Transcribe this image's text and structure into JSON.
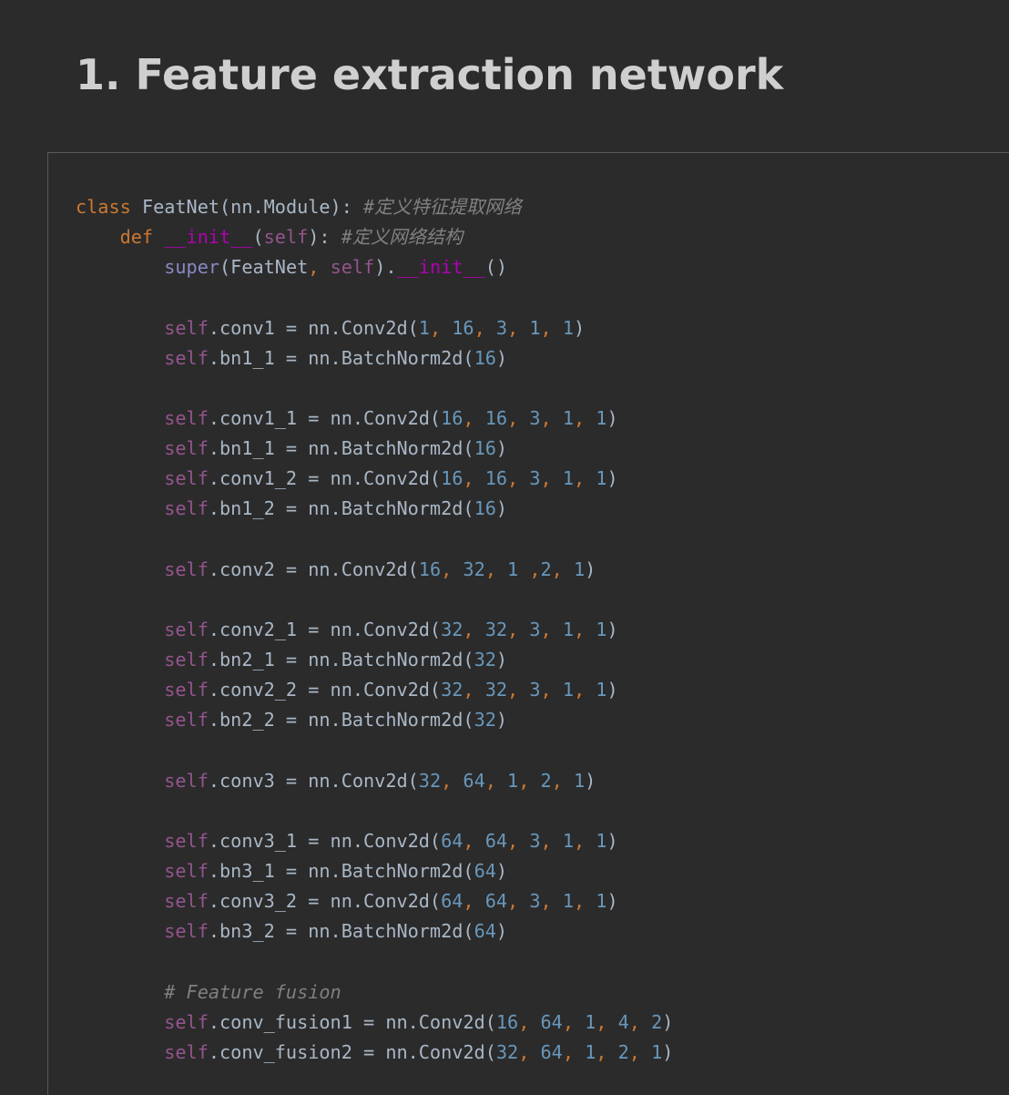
{
  "heading": "1. Feature extraction network",
  "colors": {
    "background": "#2b2b2b",
    "heading": "#cfcfcf",
    "keyword": "#cc7832",
    "self": "#94558d",
    "number": "#6897bb",
    "comment": "#808080",
    "magic": "#b200b2",
    "builtin": "#8888c6",
    "default": "#a9b7c6",
    "border": "#5a5a5a"
  },
  "code": {
    "lines": [
      [
        {
          "t": "kw",
          "v": "class "
        },
        {
          "t": "text",
          "v": "FeatNet(nn.Module): "
        },
        {
          "t": "comment",
          "v": "#定义特征提取网络"
        }
      ],
      [
        {
          "t": "ws",
          "v": "    "
        },
        {
          "t": "kw",
          "v": "def "
        },
        {
          "t": "magic",
          "v": "__init__"
        },
        {
          "t": "text",
          "v": "("
        },
        {
          "t": "self",
          "v": "self"
        },
        {
          "t": "text",
          "v": "): "
        },
        {
          "t": "comment",
          "v": "#定义网络结构"
        }
      ],
      [
        {
          "t": "ws",
          "v": "        "
        },
        {
          "t": "builtin",
          "v": "super"
        },
        {
          "t": "text",
          "v": "(FeatNet"
        },
        {
          "t": "punct",
          "v": ", "
        },
        {
          "t": "self",
          "v": "self"
        },
        {
          "t": "text",
          "v": ")."
        },
        {
          "t": "magic",
          "v": "__init__"
        },
        {
          "t": "text",
          "v": "()"
        }
      ],
      [],
      [
        {
          "t": "ws",
          "v": "        "
        },
        {
          "t": "self",
          "v": "self"
        },
        {
          "t": "text",
          "v": ".conv1 = nn.Conv2d("
        },
        {
          "t": "num",
          "v": "1"
        },
        {
          "t": "punct",
          "v": ", "
        },
        {
          "t": "num",
          "v": "16"
        },
        {
          "t": "punct",
          "v": ", "
        },
        {
          "t": "num",
          "v": "3"
        },
        {
          "t": "punct",
          "v": ", "
        },
        {
          "t": "num",
          "v": "1"
        },
        {
          "t": "punct",
          "v": ", "
        },
        {
          "t": "num",
          "v": "1"
        },
        {
          "t": "text",
          "v": ")"
        }
      ],
      [
        {
          "t": "ws",
          "v": "        "
        },
        {
          "t": "self",
          "v": "self"
        },
        {
          "t": "text",
          "v": ".bn1_1 = nn.BatchNorm2d("
        },
        {
          "t": "num",
          "v": "16"
        },
        {
          "t": "text",
          "v": ")"
        }
      ],
      [],
      [
        {
          "t": "ws",
          "v": "        "
        },
        {
          "t": "self",
          "v": "self"
        },
        {
          "t": "text",
          "v": ".conv1_1 = nn.Conv2d("
        },
        {
          "t": "num",
          "v": "16"
        },
        {
          "t": "punct",
          "v": ", "
        },
        {
          "t": "num",
          "v": "16"
        },
        {
          "t": "punct",
          "v": ", "
        },
        {
          "t": "num",
          "v": "3"
        },
        {
          "t": "punct",
          "v": ", "
        },
        {
          "t": "num",
          "v": "1"
        },
        {
          "t": "punct",
          "v": ", "
        },
        {
          "t": "num",
          "v": "1"
        },
        {
          "t": "text",
          "v": ")"
        }
      ],
      [
        {
          "t": "ws",
          "v": "        "
        },
        {
          "t": "self",
          "v": "self"
        },
        {
          "t": "text",
          "v": ".bn1_1 = nn.BatchNorm2d("
        },
        {
          "t": "num",
          "v": "16"
        },
        {
          "t": "text",
          "v": ")"
        }
      ],
      [
        {
          "t": "ws",
          "v": "        "
        },
        {
          "t": "self",
          "v": "self"
        },
        {
          "t": "text",
          "v": ".conv1_2 = nn.Conv2d("
        },
        {
          "t": "num",
          "v": "16"
        },
        {
          "t": "punct",
          "v": ", "
        },
        {
          "t": "num",
          "v": "16"
        },
        {
          "t": "punct",
          "v": ", "
        },
        {
          "t": "num",
          "v": "3"
        },
        {
          "t": "punct",
          "v": ", "
        },
        {
          "t": "num",
          "v": "1"
        },
        {
          "t": "punct",
          "v": ", "
        },
        {
          "t": "num",
          "v": "1"
        },
        {
          "t": "text",
          "v": ")"
        }
      ],
      [
        {
          "t": "ws",
          "v": "        "
        },
        {
          "t": "self",
          "v": "self"
        },
        {
          "t": "text",
          "v": ".bn1_2 = nn.BatchNorm2d("
        },
        {
          "t": "num",
          "v": "16"
        },
        {
          "t": "text",
          "v": ")"
        }
      ],
      [],
      [
        {
          "t": "ws",
          "v": "        "
        },
        {
          "t": "self",
          "v": "self"
        },
        {
          "t": "text",
          "v": ".conv2 = nn.Conv2d("
        },
        {
          "t": "num",
          "v": "16"
        },
        {
          "t": "punct",
          "v": ", "
        },
        {
          "t": "num",
          "v": "32"
        },
        {
          "t": "punct",
          "v": ", "
        },
        {
          "t": "num",
          "v": "1"
        },
        {
          "t": "punct",
          "v": " ,"
        },
        {
          "t": "num",
          "v": "2"
        },
        {
          "t": "punct",
          "v": ", "
        },
        {
          "t": "num",
          "v": "1"
        },
        {
          "t": "text",
          "v": ")"
        }
      ],
      [],
      [
        {
          "t": "ws",
          "v": "        "
        },
        {
          "t": "self",
          "v": "self"
        },
        {
          "t": "text",
          "v": ".conv2_1 = nn.Conv2d("
        },
        {
          "t": "num",
          "v": "32"
        },
        {
          "t": "punct",
          "v": ", "
        },
        {
          "t": "num",
          "v": "32"
        },
        {
          "t": "punct",
          "v": ", "
        },
        {
          "t": "num",
          "v": "3"
        },
        {
          "t": "punct",
          "v": ", "
        },
        {
          "t": "num",
          "v": "1"
        },
        {
          "t": "punct",
          "v": ", "
        },
        {
          "t": "num",
          "v": "1"
        },
        {
          "t": "text",
          "v": ")"
        }
      ],
      [
        {
          "t": "ws",
          "v": "        "
        },
        {
          "t": "self",
          "v": "self"
        },
        {
          "t": "text",
          "v": ".bn2_1 = nn.BatchNorm2d("
        },
        {
          "t": "num",
          "v": "32"
        },
        {
          "t": "text",
          "v": ")"
        }
      ],
      [
        {
          "t": "ws",
          "v": "        "
        },
        {
          "t": "self",
          "v": "self"
        },
        {
          "t": "text",
          "v": ".conv2_2 = nn.Conv2d("
        },
        {
          "t": "num",
          "v": "32"
        },
        {
          "t": "punct",
          "v": ", "
        },
        {
          "t": "num",
          "v": "32"
        },
        {
          "t": "punct",
          "v": ", "
        },
        {
          "t": "num",
          "v": "3"
        },
        {
          "t": "punct",
          "v": ", "
        },
        {
          "t": "num",
          "v": "1"
        },
        {
          "t": "punct",
          "v": ", "
        },
        {
          "t": "num",
          "v": "1"
        },
        {
          "t": "text",
          "v": ")"
        }
      ],
      [
        {
          "t": "ws",
          "v": "        "
        },
        {
          "t": "self",
          "v": "self"
        },
        {
          "t": "text",
          "v": ".bn2_2 = nn.BatchNorm2d("
        },
        {
          "t": "num",
          "v": "32"
        },
        {
          "t": "text",
          "v": ")"
        }
      ],
      [],
      [
        {
          "t": "ws",
          "v": "        "
        },
        {
          "t": "self",
          "v": "self"
        },
        {
          "t": "text",
          "v": ".conv3 = nn.Conv2d("
        },
        {
          "t": "num",
          "v": "32"
        },
        {
          "t": "punct",
          "v": ", "
        },
        {
          "t": "num",
          "v": "64"
        },
        {
          "t": "punct",
          "v": ", "
        },
        {
          "t": "num",
          "v": "1"
        },
        {
          "t": "punct",
          "v": ", "
        },
        {
          "t": "num",
          "v": "2"
        },
        {
          "t": "punct",
          "v": ", "
        },
        {
          "t": "num",
          "v": "1"
        },
        {
          "t": "text",
          "v": ")"
        }
      ],
      [],
      [
        {
          "t": "ws",
          "v": "        "
        },
        {
          "t": "self",
          "v": "self"
        },
        {
          "t": "text",
          "v": ".conv3_1 = nn.Conv2d("
        },
        {
          "t": "num",
          "v": "64"
        },
        {
          "t": "punct",
          "v": ", "
        },
        {
          "t": "num",
          "v": "64"
        },
        {
          "t": "punct",
          "v": ", "
        },
        {
          "t": "num",
          "v": "3"
        },
        {
          "t": "punct",
          "v": ", "
        },
        {
          "t": "num",
          "v": "1"
        },
        {
          "t": "punct",
          "v": ", "
        },
        {
          "t": "num",
          "v": "1"
        },
        {
          "t": "text",
          "v": ")"
        }
      ],
      [
        {
          "t": "ws",
          "v": "        "
        },
        {
          "t": "self",
          "v": "self"
        },
        {
          "t": "text",
          "v": ".bn3_1 = nn.BatchNorm2d("
        },
        {
          "t": "num",
          "v": "64"
        },
        {
          "t": "text",
          "v": ")"
        }
      ],
      [
        {
          "t": "ws",
          "v": "        "
        },
        {
          "t": "self",
          "v": "self"
        },
        {
          "t": "text",
          "v": ".conv3_2 = nn.Conv2d("
        },
        {
          "t": "num",
          "v": "64"
        },
        {
          "t": "punct",
          "v": ", "
        },
        {
          "t": "num",
          "v": "64"
        },
        {
          "t": "punct",
          "v": ", "
        },
        {
          "t": "num",
          "v": "3"
        },
        {
          "t": "punct",
          "v": ", "
        },
        {
          "t": "num",
          "v": "1"
        },
        {
          "t": "punct",
          "v": ", "
        },
        {
          "t": "num",
          "v": "1"
        },
        {
          "t": "text",
          "v": ")"
        }
      ],
      [
        {
          "t": "ws",
          "v": "        "
        },
        {
          "t": "self",
          "v": "self"
        },
        {
          "t": "text",
          "v": ".bn3_2 = nn.BatchNorm2d("
        },
        {
          "t": "num",
          "v": "64"
        },
        {
          "t": "text",
          "v": ")"
        }
      ],
      [],
      [
        {
          "t": "ws",
          "v": "        "
        },
        {
          "t": "comment",
          "v": "# Feature fusion"
        }
      ],
      [
        {
          "t": "ws",
          "v": "        "
        },
        {
          "t": "self",
          "v": "self"
        },
        {
          "t": "text",
          "v": ".conv_fusion1 = nn.Conv2d("
        },
        {
          "t": "num",
          "v": "16"
        },
        {
          "t": "punct",
          "v": ", "
        },
        {
          "t": "num",
          "v": "64"
        },
        {
          "t": "punct",
          "v": ", "
        },
        {
          "t": "num",
          "v": "1"
        },
        {
          "t": "punct",
          "v": ", "
        },
        {
          "t": "num",
          "v": "4"
        },
        {
          "t": "punct",
          "v": ", "
        },
        {
          "t": "num",
          "v": "2"
        },
        {
          "t": "text",
          "v": ")"
        }
      ],
      [
        {
          "t": "ws",
          "v": "        "
        },
        {
          "t": "self",
          "v": "self"
        },
        {
          "t": "text",
          "v": ".conv_fusion2 = nn.Conv2d("
        },
        {
          "t": "num",
          "v": "32"
        },
        {
          "t": "punct",
          "v": ", "
        },
        {
          "t": "num",
          "v": "64"
        },
        {
          "t": "punct",
          "v": ", "
        },
        {
          "t": "num",
          "v": "1"
        },
        {
          "t": "punct",
          "v": ", "
        },
        {
          "t": "num",
          "v": "2"
        },
        {
          "t": "punct",
          "v": ", "
        },
        {
          "t": "num",
          "v": "1"
        },
        {
          "t": "text",
          "v": ")"
        }
      ]
    ]
  }
}
